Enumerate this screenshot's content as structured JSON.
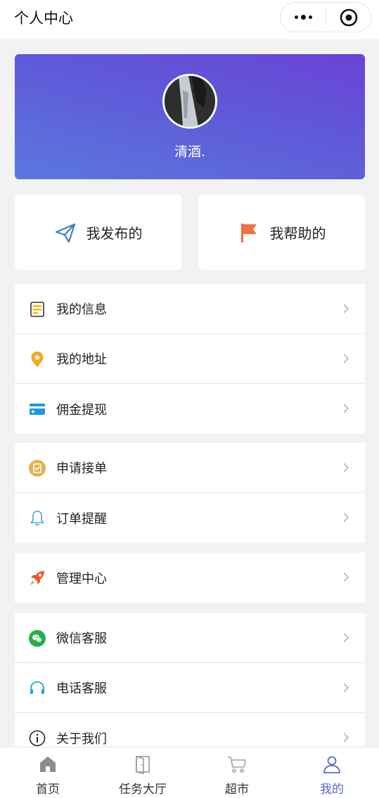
{
  "navbar": {
    "title": "个人中心"
  },
  "profile": {
    "name": "清酒."
  },
  "cards": [
    {
      "label": "我发布的",
      "icon": "paper-plane-icon",
      "color": "#3b82c4"
    },
    {
      "label": "我帮助的",
      "icon": "flag-icon",
      "color": "#f07042"
    }
  ],
  "menu_groups": [
    [
      {
        "label": "我的信息",
        "icon": "document-icon"
      },
      {
        "label": "我的地址",
        "icon": "location-pin-icon"
      },
      {
        "label": "佣金提现",
        "icon": "card-icon"
      }
    ],
    [
      {
        "label": "申请接单",
        "icon": "clipboard-check-icon"
      },
      {
        "label": "订单提醒",
        "icon": "bell-icon"
      }
    ],
    [
      {
        "label": "管理中心",
        "icon": "rocket-icon"
      }
    ],
    [
      {
        "label": "微信客服",
        "icon": "wechat-icon"
      },
      {
        "label": "电话客服",
        "icon": "headset-icon"
      },
      {
        "label": "关于我们",
        "icon": "info-icon"
      }
    ]
  ],
  "tabbar": [
    {
      "label": "首页",
      "icon": "home-icon"
    },
    {
      "label": "任务大厅",
      "icon": "door-icon"
    },
    {
      "label": "超市",
      "icon": "cart-icon"
    },
    {
      "label": "我的",
      "icon": "user-icon",
      "active": true
    }
  ],
  "colors": {
    "accent": "#5a66c8",
    "hero_start": "#6a43d4",
    "hero_end": "#5a78de"
  }
}
